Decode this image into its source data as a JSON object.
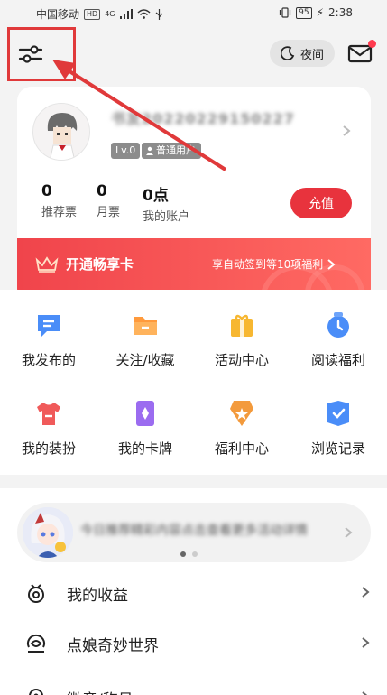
{
  "status_bar": {
    "carrier": "中国移动",
    "hd_badge": "HD",
    "network": "4G",
    "battery": "95",
    "time": "2:38"
  },
  "header": {
    "night_mode_label": "夜间",
    "has_unread_mail": true
  },
  "profile": {
    "username": "书友20220229150227",
    "level": "Lv.0",
    "user_type": "普通用户",
    "stats": [
      {
        "value": "0",
        "label": "推荐票"
      },
      {
        "value": "0",
        "label": "月票"
      },
      {
        "value": "0点",
        "label": "我的账户"
      }
    ],
    "recharge_label": "充值"
  },
  "vip_banner": {
    "title": "开通畅享卡",
    "promo": "享自动签到等10项福利"
  },
  "grid": [
    {
      "label": "我发布的",
      "icon": "message-icon",
      "color": "#4a8df8"
    },
    {
      "label": "关注/收藏",
      "icon": "folder-icon",
      "color": "#ff9a3c"
    },
    {
      "label": "活动中心",
      "icon": "gift-icon",
      "color": "#f7b731"
    },
    {
      "label": "阅读福利",
      "icon": "clock-icon",
      "color": "#4a8df8"
    },
    {
      "label": "我的装扮",
      "icon": "tshirt-icon",
      "color": "#f05a5a"
    },
    {
      "label": "我的卡牌",
      "icon": "card-icon",
      "color": "#9b6cf0"
    },
    {
      "label": "福利中心",
      "icon": "badge-icon",
      "color": "#f39a3c"
    },
    {
      "label": "浏览记录",
      "icon": "bookmark-icon",
      "color": "#4a8df8"
    }
  ],
  "carousel": {
    "text": "今日推荐精彩内容点击查看更多活动详情",
    "active_index": 0,
    "count": 2
  },
  "menu": [
    {
      "label": "我的收益",
      "icon": "income-icon"
    },
    {
      "label": "点娘奇妙世界",
      "icon": "world-icon"
    },
    {
      "label": "徽章/称号",
      "icon": "medal-icon"
    }
  ]
}
